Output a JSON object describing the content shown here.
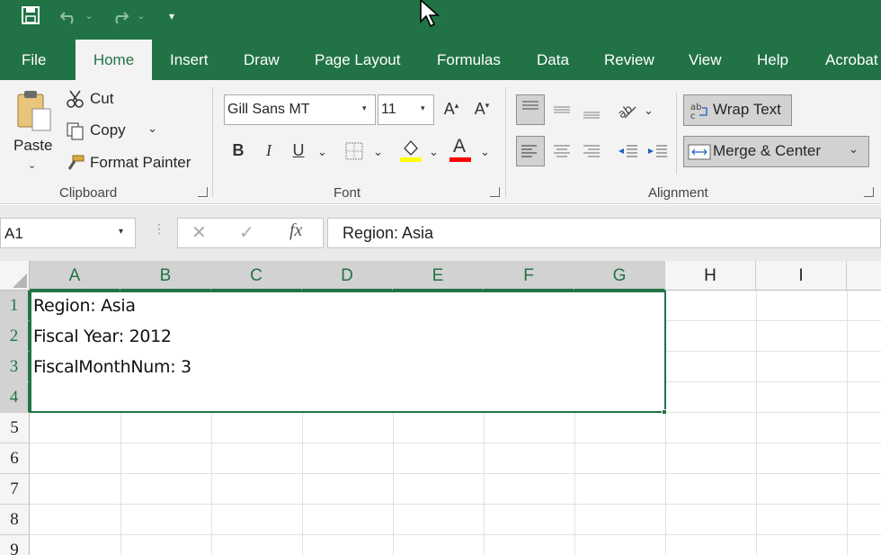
{
  "quick_access": {
    "save_icon": "save-icon",
    "undo_icon": "undo-icon",
    "redo_icon": "redo-icon",
    "customize_icon": "customize-qat-icon"
  },
  "tabs": [
    {
      "label": "File"
    },
    {
      "label": "Home"
    },
    {
      "label": "Insert"
    },
    {
      "label": "Draw"
    },
    {
      "label": "Page Layout"
    },
    {
      "label": "Formulas"
    },
    {
      "label": "Data"
    },
    {
      "label": "Review"
    },
    {
      "label": "View"
    },
    {
      "label": "Help"
    },
    {
      "label": "Acrobat"
    }
  ],
  "active_tab": "Home",
  "ribbon": {
    "clipboard": {
      "paste_label": "Paste",
      "cut_label": "Cut",
      "copy_label": "Copy",
      "format_painter_label": "Format Painter",
      "group_label": "Clipboard"
    },
    "font": {
      "font_name": "Gill Sans MT",
      "font_size": "11",
      "bold": "B",
      "italic": "I",
      "underline": "U",
      "highlight_color": "#ffff00",
      "font_color": "#ff0000",
      "font_color_glyph": "A",
      "group_label": "Font"
    },
    "alignment": {
      "wrap_text_label": "Wrap Text",
      "merge_center_label": "Merge & Center",
      "group_label": "Alignment"
    }
  },
  "formula_bar": {
    "name_box": "A1",
    "fx_label": "fx",
    "formula": "Region: Asia"
  },
  "grid": {
    "columns": [
      "A",
      "B",
      "C",
      "D",
      "E",
      "F",
      "G",
      "H",
      "I"
    ],
    "rows": [
      "1",
      "2",
      "3",
      "4",
      "5",
      "6",
      "7",
      "8",
      "9"
    ],
    "cells": [
      {
        "ref": "A1",
        "value": "Region: Asia"
      },
      {
        "ref": "A2",
        "value": "Fiscal Year: 2012"
      },
      {
        "ref": "A3",
        "value": "FiscalMonthNum: 3"
      },
      {
        "ref": "A4",
        "value": ""
      }
    ],
    "selection": "A1:G4"
  },
  "colors": {
    "accent": "#217346",
    "ribbon_bg": "#f3f3f3",
    "selection_border": "#217346"
  }
}
